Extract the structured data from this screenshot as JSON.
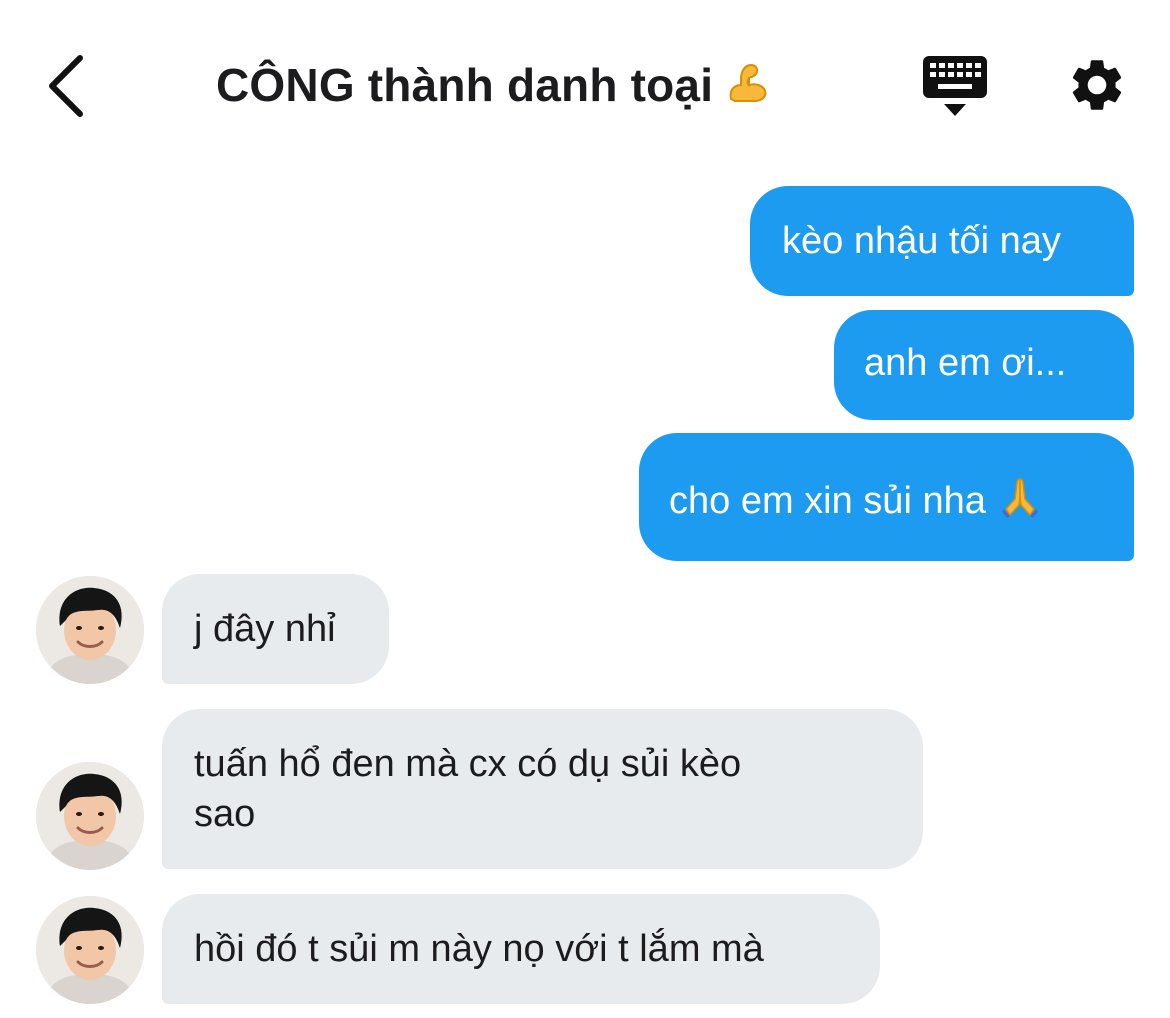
{
  "header": {
    "title": "CÔNG thành danh toại",
    "title_emoji": "flexed-biceps-icon"
  },
  "colors": {
    "outgoing_bubble": "#1d9bf0",
    "incoming_bubble": "#e8ebee",
    "text_dark": "#1c1c1e"
  },
  "messages": [
    {
      "direction": "out",
      "text": "kèo nhậu tối nay"
    },
    {
      "direction": "out",
      "text": "anh em ơi..."
    },
    {
      "direction": "out",
      "text": "cho em xin sủi nha",
      "emoji": "folded-hands-icon"
    },
    {
      "direction": "in",
      "text": "j đây nhỉ"
    },
    {
      "direction": "in",
      "line1": "tuấn hổ đen mà cx có dụ sủi kèo",
      "line2": "sao"
    },
    {
      "direction": "in",
      "text": "hồi đó t sủi m này nọ với t lắm mà"
    }
  ]
}
